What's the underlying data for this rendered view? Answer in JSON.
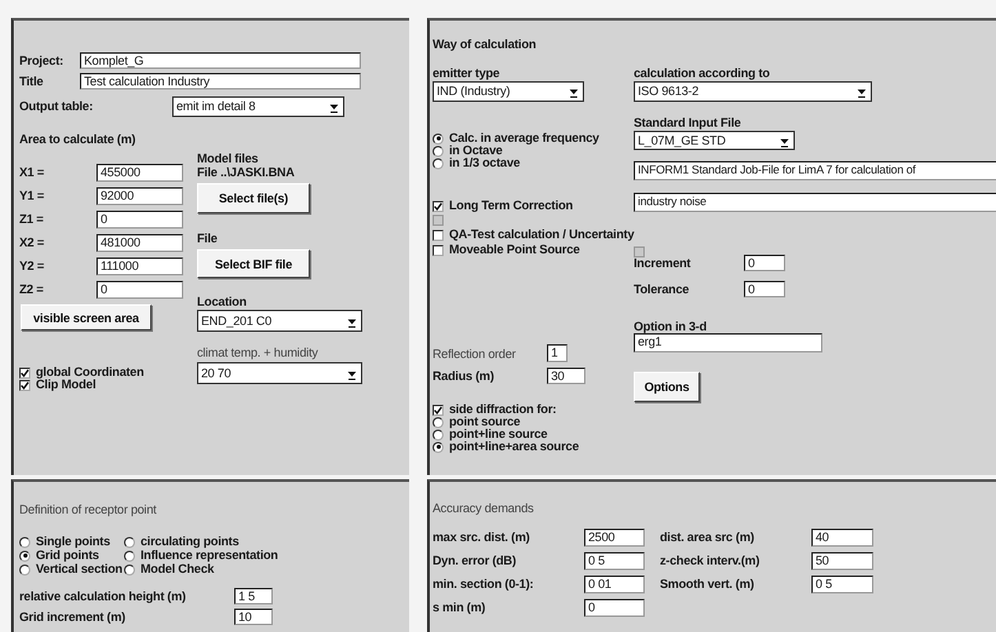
{
  "project_panel": {
    "project": {
      "label": "Project:",
      "value": "Komplet_G"
    },
    "title": {
      "label": "Title",
      "value": "Test calculation Industry"
    },
    "output_table": {
      "label": "Output table:",
      "value": "emit im detail  8"
    },
    "area_heading": "Area to calculate (m)",
    "coordinates": [
      {
        "label": "X1 =",
        "value": "455000"
      },
      {
        "label": "Y1 =",
        "value": "92000"
      },
      {
        "label": "Z1 =",
        "value": "0"
      },
      {
        "label": "X2 =",
        "value": "481000"
      },
      {
        "label": "Y2 =",
        "value": "111000"
      },
      {
        "label": "Z2 =",
        "value": "0"
      }
    ],
    "model_files": {
      "heading": "Model files",
      "file": "File  ..\\JASKI.BNA",
      "button": "Select file(s)"
    },
    "bif_file": {
      "heading": "File",
      "button": "Select BIF file"
    },
    "visible_area_button": "visible screen area",
    "location": {
      "label": "Location",
      "value": "END_201 C0"
    },
    "climate": {
      "label": "climat temp. + humidity",
      "value": "20 70"
    },
    "options": [
      {
        "label": "global Coordinaten",
        "checked": true
      },
      {
        "label": "Clip Model",
        "checked": true
      }
    ]
  },
  "calculation_panel": {
    "heading": "Way of calculation",
    "emitter_type": {
      "label": "emitter type",
      "value": "IND (Industry)"
    },
    "calculation_standard": {
      "label": "calculation according to",
      "value": "ISO 9613-2"
    },
    "standard_input_file": {
      "label": "Standard Input File",
      "value": "L_07M_GE STD"
    },
    "frequency_options": [
      {
        "label": "Calc. in average frequency",
        "selected": true
      },
      {
        "label": "in Octave",
        "selected": false
      },
      {
        "label": "in 1/3 octave",
        "selected": false
      }
    ],
    "description_lines": [
      "INFORM1   Standard Job-File for LimA 7 for calculation of",
      "industry noise"
    ],
    "checkboxes": [
      {
        "label": "Long Term Correction",
        "checked": true,
        "disabled": false
      },
      {
        "checked": false,
        "disabled": true
      },
      {
        "label": "QA-Test calculation / Uncertainty",
        "checked": false,
        "disabled": false
      },
      {
        "label": "Moveable Point Source",
        "checked": false,
        "disabled": false
      }
    ],
    "moveable": {
      "checkbox": {
        "checked": false,
        "disabled": true
      },
      "increment": {
        "label": "Increment",
        "value": "0"
      },
      "tolerance": {
        "label": "Tolerance",
        "value": "0"
      }
    },
    "option_3d": {
      "label": "Option in 3-d",
      "value": "erg1"
    },
    "reflection_order": {
      "label": "Reflection order",
      "value": "1"
    },
    "radius": {
      "label": "Radius (m)",
      "value": "30"
    },
    "options_button": "Options",
    "side_diffraction": {
      "label": "side diffraction for:",
      "checked": true
    },
    "diffraction_sources": [
      {
        "label": "point source",
        "selected": false
      },
      {
        "label": "point+line source",
        "selected": false
      },
      {
        "label": "point+line+area source",
        "selected": true
      }
    ]
  },
  "receptor_panel": {
    "heading": "Definition of receptor point",
    "options": [
      {
        "label": "Single points",
        "selected": false
      },
      {
        "label": "circulating points",
        "selected": false
      },
      {
        "label": "Grid points",
        "selected": true
      },
      {
        "label": "Influence representation",
        "selected": false
      },
      {
        "label": "Vertical section",
        "selected": false
      },
      {
        "label": "Model Check",
        "selected": false
      }
    ],
    "relative_height": {
      "label": "relative calculation height (m)",
      "value": "1 5"
    },
    "grid_increment": {
      "label": "Grid increment (m)",
      "value": "10"
    }
  },
  "accuracy_panel": {
    "heading": "Accuracy demands",
    "fields": [
      {
        "label": "max src. dist. (m)",
        "value": "2500"
      },
      {
        "label": "dist. area src (m)",
        "value": "40"
      },
      {
        "label": "Dyn. error  (dB)",
        "value": "0 5"
      },
      {
        "label": "z-check interv.(m)",
        "value": "50"
      },
      {
        "label": "min. section (0-1):",
        "value": "0 01"
      },
      {
        "label": "Smooth vert. (m)",
        "value": "0 5"
      },
      {
        "label": "s min (m)",
        "value": "0"
      }
    ]
  }
}
